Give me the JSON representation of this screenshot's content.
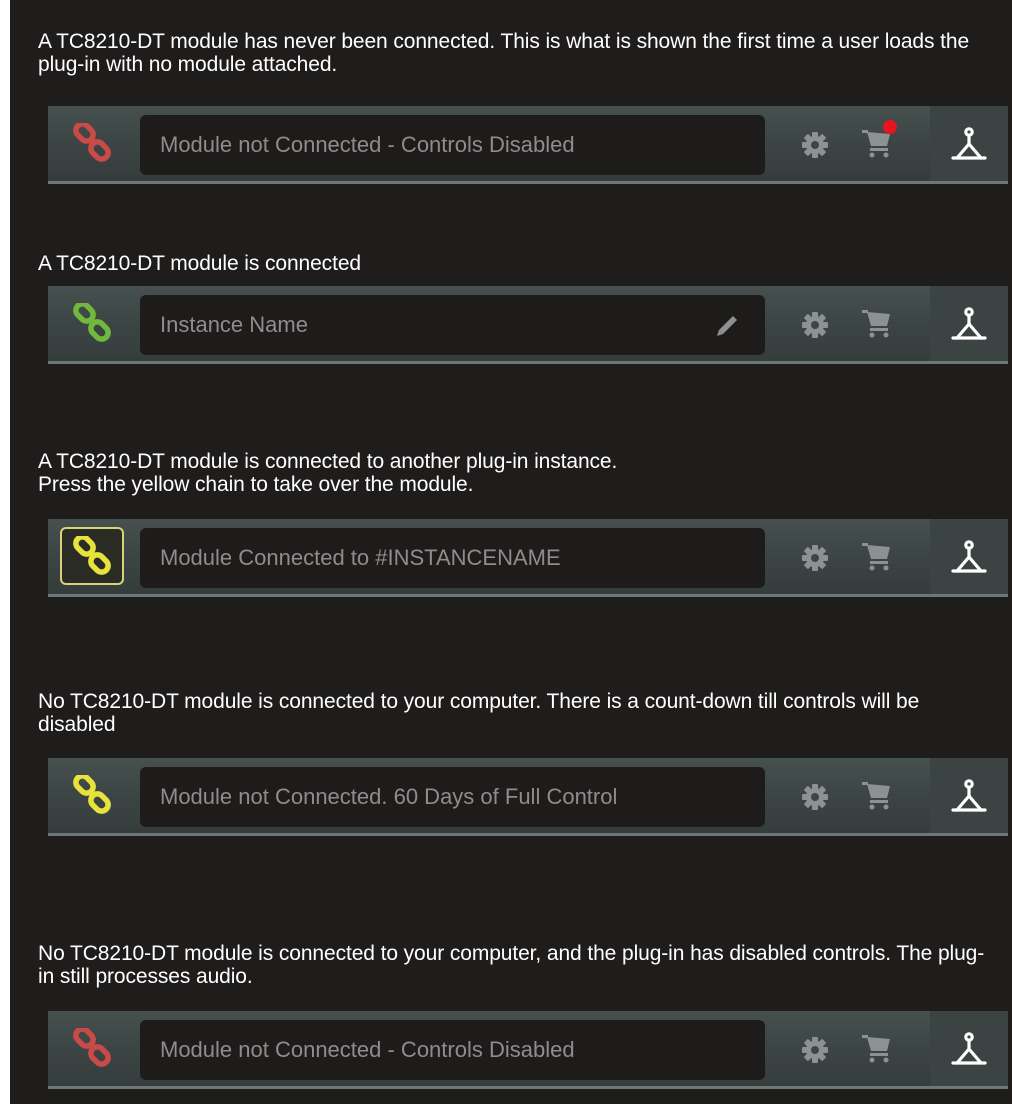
{
  "rows": [
    {
      "description": "A TC8210-DT  module has never been connected. This is what is shown the first time a user loads the plug-in with no module attached.",
      "field_text": "Module not Connected - Controls Disabled",
      "chain_state": "red",
      "chain_icon": "chain-link-icon",
      "show_pencil": false,
      "cart_notification": true
    },
    {
      "description": "A TC8210-DT module  is connected",
      "field_text": "Instance Name",
      "chain_state": "green",
      "chain_icon": "chain-link-icon",
      "show_pencil": true,
      "cart_notification": false
    },
    {
      "description": "A TC8210-DT module  is connected to another plug-in instance.\nPress the yellow chain to take over the module.",
      "field_text": "Module Connected to #INSTANCENAME",
      "chain_state": "yellow-boxed",
      "chain_icon": "chain-link-icon",
      "show_pencil": false,
      "cart_notification": false
    },
    {
      "description": "No TC8210-DT module  is connected to your computer. There is a count-down till controls will be disabled",
      "field_text": "Module not Connected. 60 Days of Full Control",
      "chain_state": "yellow",
      "chain_icon": "chain-link-icon",
      "show_pencil": false,
      "cart_notification": false
    },
    {
      "description": "No TC8210-DT module  is connected to your computer, and the plug-in has disabled controls. The plug-in still processes audio.",
      "field_text": "Module not Connected - Controls Disabled",
      "chain_state": "red",
      "chain_icon": "chain-link-icon",
      "show_pencil": false,
      "cart_notification": false
    }
  ],
  "colors": {
    "panel_bg": "#1f1c1c",
    "chain_red": "#c94a46",
    "chain_green": "#72b83a",
    "chain_yellow": "#e8e33c",
    "icon_gray": "#8c9291",
    "cart_notification": "#e8141e"
  },
  "toolbar_icons": [
    "gear-icon",
    "cart-icon",
    "logo-icon"
  ]
}
